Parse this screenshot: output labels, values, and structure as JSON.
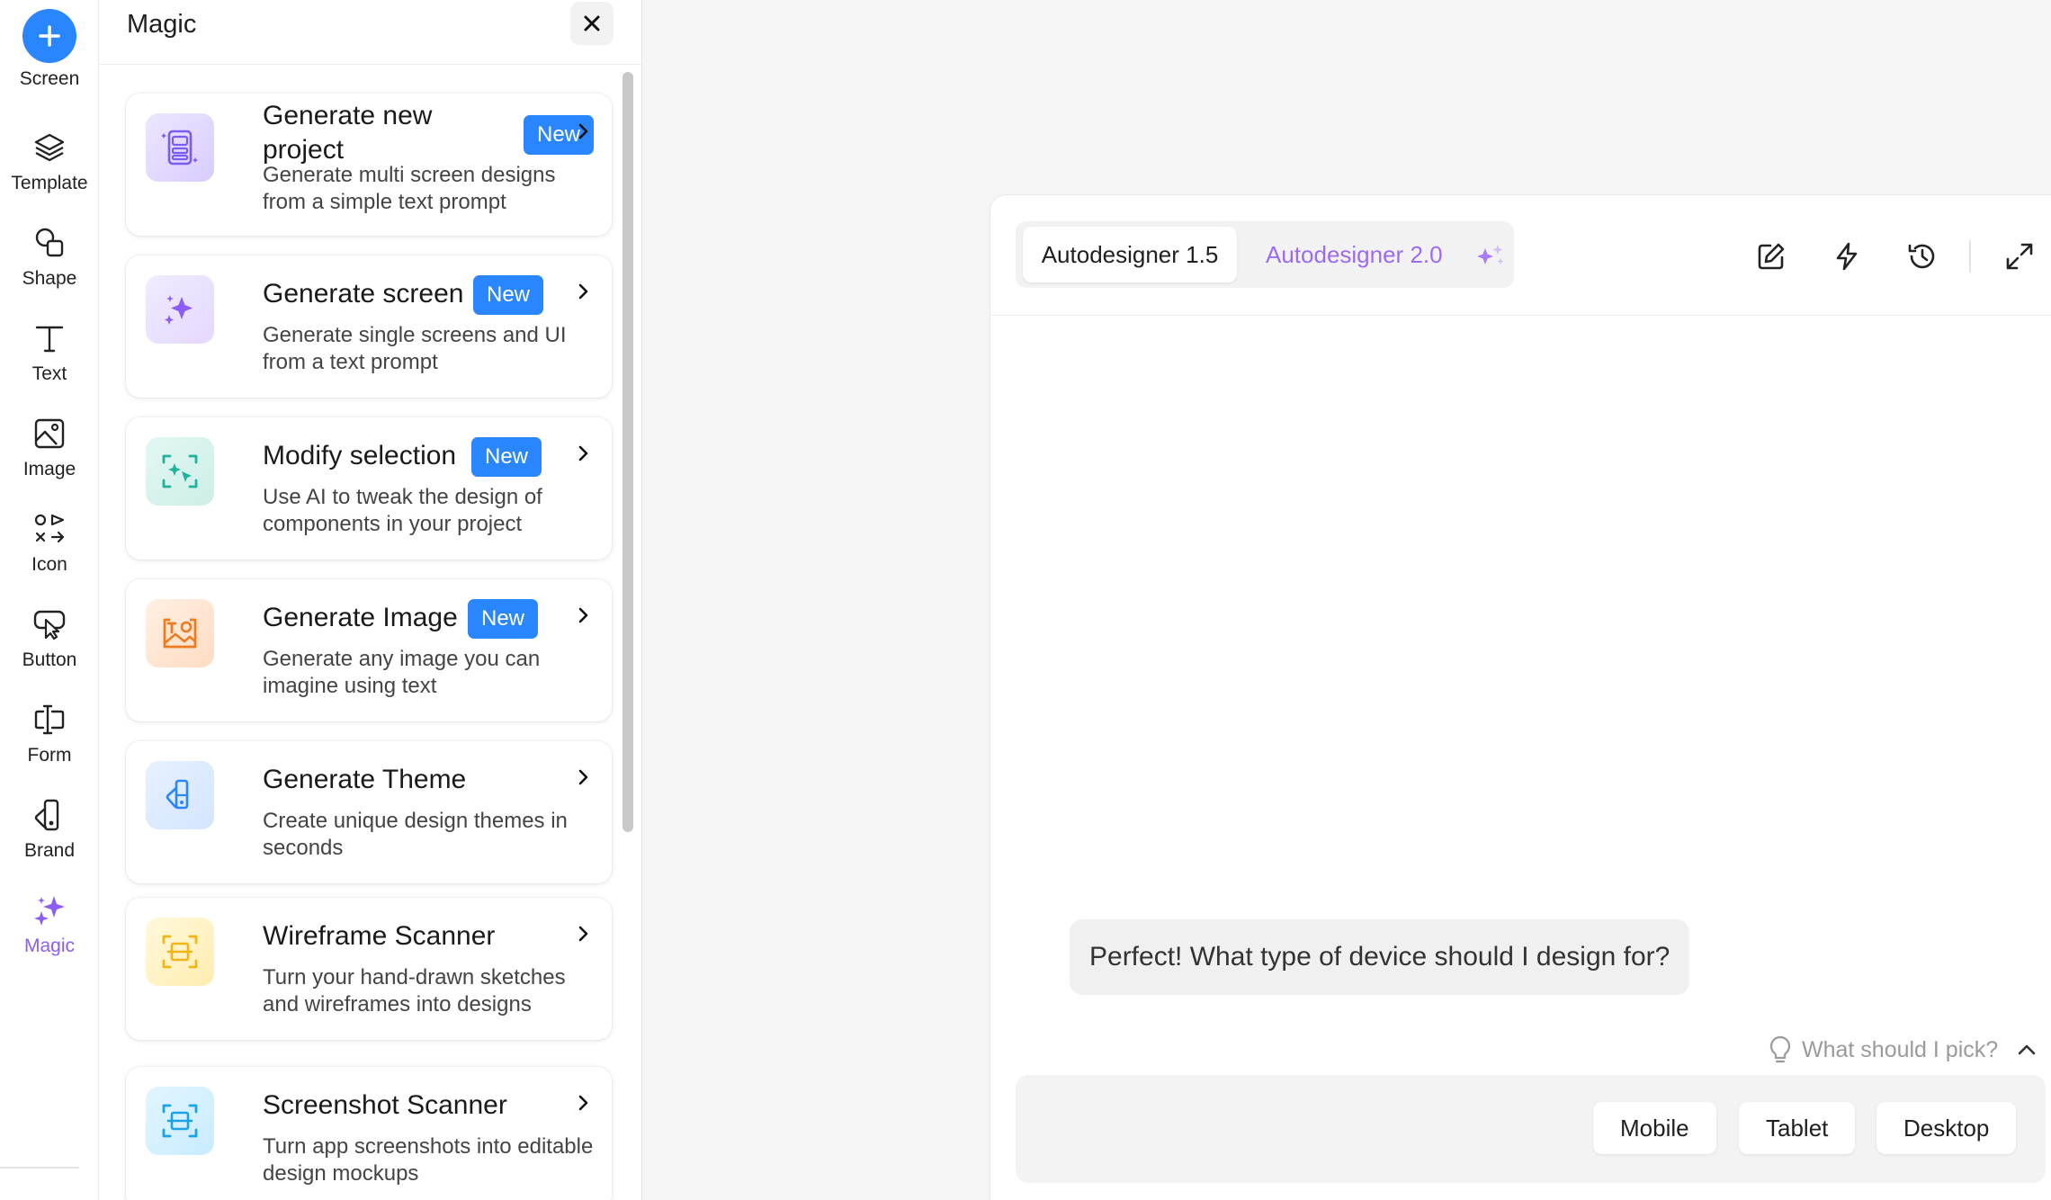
{
  "rail": {
    "items": [
      {
        "label": "Screen"
      },
      {
        "label": "Template"
      },
      {
        "label": "Shape"
      },
      {
        "label": "Text"
      },
      {
        "label": "Image"
      },
      {
        "label": "Icon"
      },
      {
        "label": "Button"
      },
      {
        "label": "Form"
      },
      {
        "label": "Brand"
      },
      {
        "label": "Magic"
      }
    ],
    "active": "Magic"
  },
  "panel": {
    "title": "Magic",
    "cards": [
      {
        "title_line1": "Generate new",
        "title_line2": "project",
        "badge": "New",
        "desc_line1": "Generate multi screen designs",
        "desc_line2": "from a simple text prompt",
        "icon": "device-screens-icon"
      },
      {
        "title": "Generate screen",
        "badge": "New",
        "desc_line1": "Generate single screens and UI",
        "desc_line2": "from a text prompt",
        "icon": "sparkles-icon"
      },
      {
        "title": "Modify selection",
        "badge": "New",
        "desc_line1": "Use AI to tweak the design of",
        "desc_line2": "components in your project",
        "icon": "selection-sparkle-icon"
      },
      {
        "title": "Generate Image",
        "badge": "New",
        "desc_line1": "Generate any image you can",
        "desc_line2": "imagine using text",
        "icon": "image-text-icon"
      },
      {
        "title": "Generate Theme",
        "desc_line1": "Create unique design themes in",
        "desc_line2": "seconds",
        "icon": "palette-icon"
      },
      {
        "title": "Wireframe Scanner",
        "desc_line1": "Turn your hand-drawn sketches",
        "desc_line2": "and wireframes into designs",
        "icon": "scan-frame-icon"
      },
      {
        "title": "Screenshot Scanner",
        "desc_line1": "Turn app screenshots into editable",
        "desc_line2": "design mockups",
        "icon": "scan-screenshot-icon"
      }
    ]
  },
  "chat": {
    "tabs": [
      {
        "label": "Autodesigner 1.5"
      },
      {
        "label": "Autodesigner 2.0"
      }
    ],
    "message": "Perfect! What type of device should I design for?",
    "hint": "What should I pick?",
    "choices": [
      {
        "label": "Mobile"
      },
      {
        "label": "Tablet"
      },
      {
        "label": "Desktop"
      }
    ]
  },
  "colors": {
    "accent": "#2a86ff",
    "magic": "#8b5cf6",
    "panel_bg": "#ffffff",
    "canvas_bg": "#f5f5f5"
  }
}
